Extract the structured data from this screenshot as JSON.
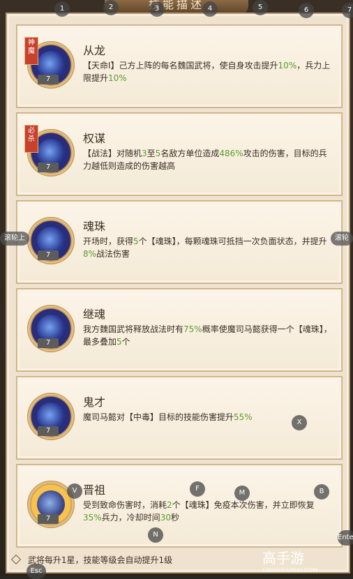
{
  "window": {
    "title": "技能描述"
  },
  "skills": [
    {
      "name": "从龙",
      "level": "7",
      "badge": "神\n魔",
      "desc_html": "【天命Ⅰ】己方上阵的每名魏国武将，使自身攻击提升<span class='g'>10%</span>，兵力上限提升<span class='g'>10%</span>"
    },
    {
      "name": "权谋",
      "level": "7",
      "badge": "必\n杀",
      "desc_html": "【战法】对随机<span class='g'>3</span>至<span class='g'>5</span>名敌方单位造成<span class='g'>486%</span>攻击的伤害，目标的兵力越低则造成的伤害越高"
    },
    {
      "name": "魂珠",
      "level": "7",
      "badge": "",
      "desc_html": "开场时，获得<span class='g'>5</span>个【魂珠】，每颗魂珠可抵挡一次负面状态，并提升<span class='g'>8%</span>战法伤害"
    },
    {
      "name": "继魂",
      "level": "7",
      "badge": "",
      "desc_html": "我方魏国武将释放战法时有<span class='g'>75%</span>概率使魔司马懿获得一个【魂珠】，最多叠加<span class='g'>5</span>个"
    },
    {
      "name": "鬼才",
      "level": "7",
      "badge": "",
      "desc_html": "魔司马懿对【中毒】目标的技能伤害提升<span class='g'>55%</span>"
    },
    {
      "name": "晋祖",
      "level": "7",
      "badge": "",
      "desc_html": "受到致命伤害时，消耗<span class='g'>2</span>个【魂珠】免疫本次伤害，并立即恢复<span class='g'>35%</span>兵力，冷却时间<span class='g'>30</span>秒"
    }
  ],
  "footer": {
    "text": "武将每升1星，技能等级会自动提升1级"
  },
  "overlay_keys": [
    "1",
    "2",
    "3",
    "4",
    "5",
    "6",
    "7",
    "V",
    "F",
    "M",
    "B",
    "X",
    "N",
    "Esc",
    "Enter"
  ],
  "side_buttons": {
    "left": "滚轮上",
    "right": "滚轮"
  },
  "logo": {
    "text": "高手游",
    "sub": "GAOSHOUYOU.COM"
  }
}
